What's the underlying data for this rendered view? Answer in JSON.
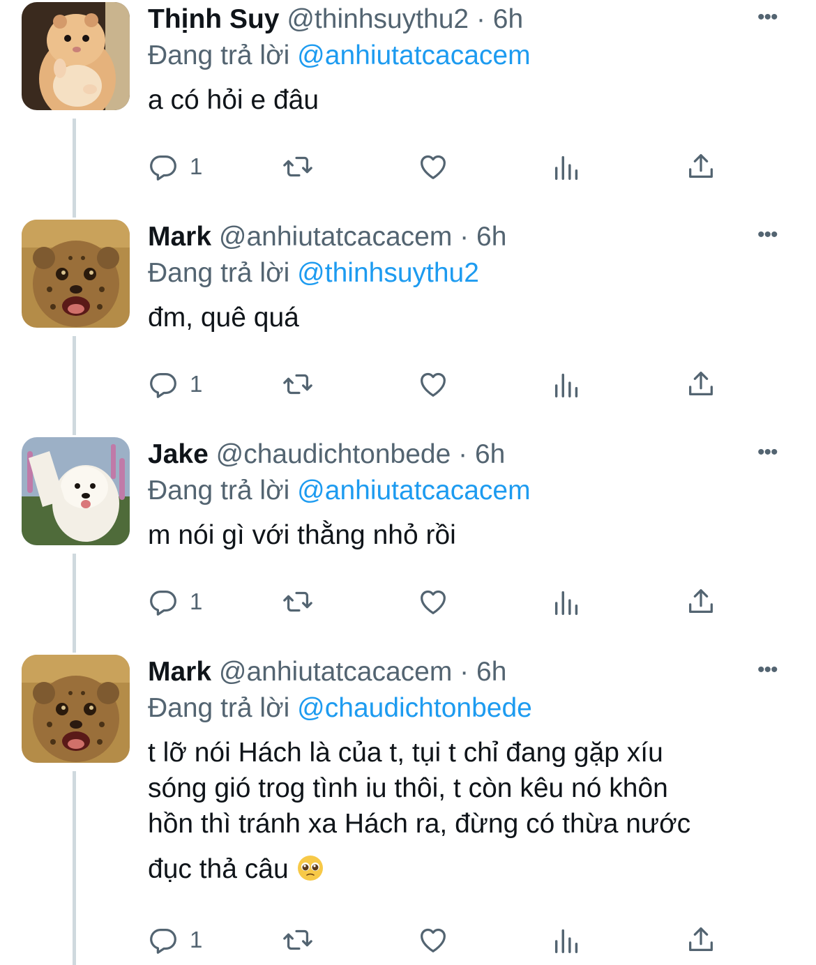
{
  "tweets": [
    {
      "name": "Thịnh Suy",
      "handle": "@thinhsuythu2",
      "dot": "·",
      "time": "6h",
      "reply_prefix": "Đang trả lời",
      "reply_to": "@anhiutatcacacem",
      "body": "a có hỏi e đâu",
      "reply_count": "1",
      "avatar_icon": "hamster-avatar"
    },
    {
      "name": "Mark",
      "handle": "@anhiutatcacacem",
      "dot": "·",
      "time": "6h",
      "reply_prefix": "Đang trả lời",
      "reply_to": "@thinhsuythu2",
      "body": "đm, quê quá",
      "reply_count": "1",
      "avatar_icon": "cheetah-cub-avatar"
    },
    {
      "name": "Jake",
      "handle": "@chaudichtonbede",
      "dot": "·",
      "time": "6h",
      "reply_prefix": "Đang trả lời",
      "reply_to": "@anhiutatcacacem",
      "body": "m nói gì với thằng nhỏ rồi",
      "reply_count": "1",
      "avatar_icon": "samoyed-dog-avatar"
    },
    {
      "name": "Mark",
      "handle": "@anhiutatcacacem",
      "dot": "·",
      "time": "6h",
      "reply_prefix": "Đang trả lời",
      "reply_to": "@chaudichtonbede",
      "body_lines": [
        "t lỡ nói Hách là của t, tụi t chỉ đang gặp xíu",
        "sóng gió trog tình iu thôi, t còn kêu nó khôn",
        "hồn thì tránh xa Hách ra, đừng có thừa nước",
        "đục thả câu"
      ],
      "body_emoji": "pleading-face-emoji",
      "reply_count": "1",
      "avatar_icon": "cheetah-cub-avatar"
    }
  ],
  "more_label": "•••",
  "icons": {
    "reply": "reply-icon",
    "retweet": "retweet-icon",
    "like": "heart-icon",
    "views": "views-icon",
    "share": "share-icon"
  },
  "colors": {
    "mention": "#1d9bf0",
    "secondary_text": "#536471",
    "thread_line": "#cfd9de"
  }
}
